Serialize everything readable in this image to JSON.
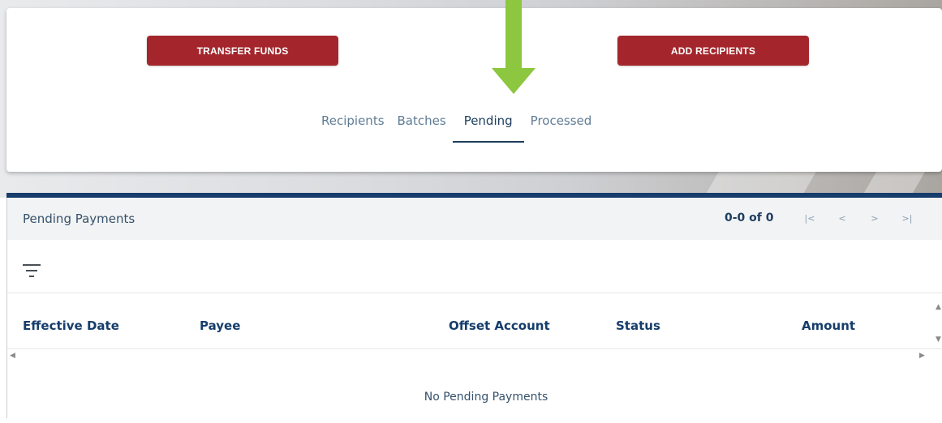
{
  "actions": {
    "transfer_funds_label": "TRANSFER FUNDS",
    "add_recipients_label": "ADD RECIPIENTS"
  },
  "tabs": [
    {
      "label": "Recipients",
      "active": false
    },
    {
      "label": "Batches",
      "active": false
    },
    {
      "label": "Pending",
      "active": true
    },
    {
      "label": "Processed",
      "active": false
    }
  ],
  "panel": {
    "title": "Pending Payments",
    "range": "0-0 of 0",
    "pager": {
      "first": "|<",
      "prev": "<",
      "next": ">",
      "last": ">|"
    }
  },
  "table": {
    "columns": [
      "Effective Date",
      "Payee",
      "Offset Account",
      "Status",
      "Amount"
    ],
    "rows": [],
    "empty_message": "No Pending Payments"
  },
  "icons": {
    "filter": "filter-icon",
    "arrow": "arrow-down-icon"
  },
  "colors": {
    "primary_button": "#a4262c",
    "annotation_arrow": "#8dc63f",
    "brand_navy": "#163d6b",
    "tab_inactive": "#5f7c95"
  }
}
